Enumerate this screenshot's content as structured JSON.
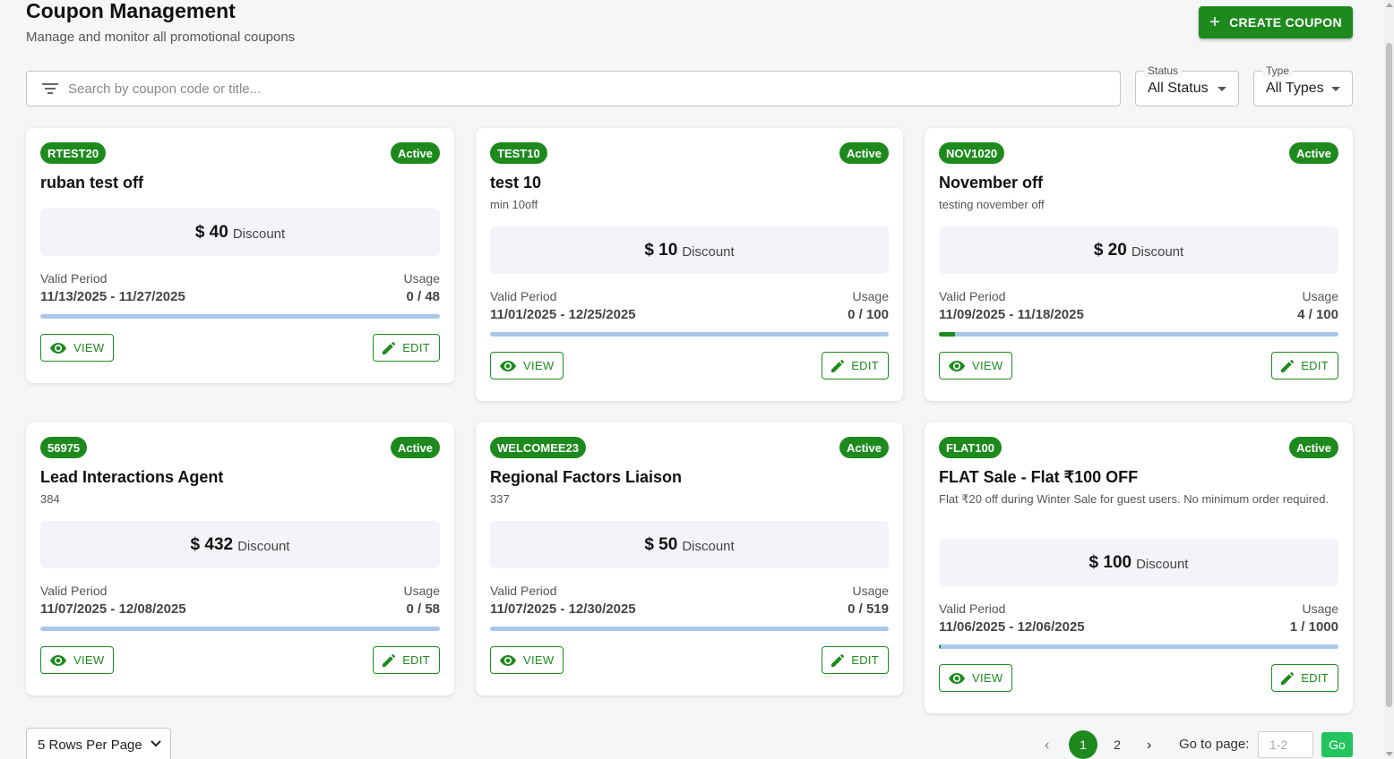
{
  "header": {
    "title": "Coupon Management",
    "subtitle": "Manage and monitor all promotional coupons",
    "create_label": "CREATE COUPON"
  },
  "filters": {
    "search_placeholder": "Search by coupon code or title...",
    "status_label": "Status",
    "status_value": "All Status",
    "type_label": "Type",
    "type_value": "All Types"
  },
  "labels": {
    "discount": "Discount",
    "valid_period": "Valid Period",
    "usage": "Usage",
    "view": "VIEW",
    "edit": "EDIT"
  },
  "coupons": [
    {
      "code": "RTEST20",
      "status": "Active",
      "title": "ruban test off",
      "description": "",
      "amount": "$ 40",
      "period": "11/13/2025 - 11/27/2025",
      "usage": "0 / 48",
      "usage_fraction": 0
    },
    {
      "code": "TEST10",
      "status": "Active",
      "title": "test 10",
      "description": "min 10off",
      "amount": "$ 10",
      "period": "11/01/2025 - 12/25/2025",
      "usage": "0 / 100",
      "usage_fraction": 0
    },
    {
      "code": "NOV1020",
      "status": "Active",
      "title": "November off",
      "description": "testing november off",
      "amount": "$ 20",
      "period": "11/09/2025 - 11/18/2025",
      "usage": "4 / 100",
      "usage_fraction": 0.04
    },
    {
      "code": "56975",
      "status": "Active",
      "title": "Lead Interactions Agent",
      "description": "384",
      "amount": "$ 432",
      "period": "11/07/2025 - 12/08/2025",
      "usage": "0 / 58",
      "usage_fraction": 0
    },
    {
      "code": "WELCOMEE23",
      "status": "Active",
      "title": "Regional Factors Liaison",
      "description": "337",
      "amount": "$ 50",
      "period": "11/07/2025 - 12/30/2025",
      "usage": "0 / 519",
      "usage_fraction": 0
    },
    {
      "code": "FLAT100",
      "status": "Active",
      "title": "FLAT Sale - Flat ₹100 OFF",
      "description": "Flat ₹20 off during Winter Sale for guest users. No minimum order required.",
      "amount": "$ 100",
      "period": "11/06/2025 - 12/06/2025",
      "usage": "1 / 1000",
      "usage_fraction": 0.001
    }
  ],
  "pagination": {
    "rows_per_page": "5 Rows Per Page",
    "pages": [
      "1",
      "2"
    ],
    "current_page": "1",
    "goto_label": "Go to page:",
    "goto_placeholder": "1-2",
    "go_label": "Go"
  },
  "colors": {
    "accent": "#1e8a1e",
    "progress_track": "#a9c7e9",
    "go_button": "#22c55e"
  }
}
